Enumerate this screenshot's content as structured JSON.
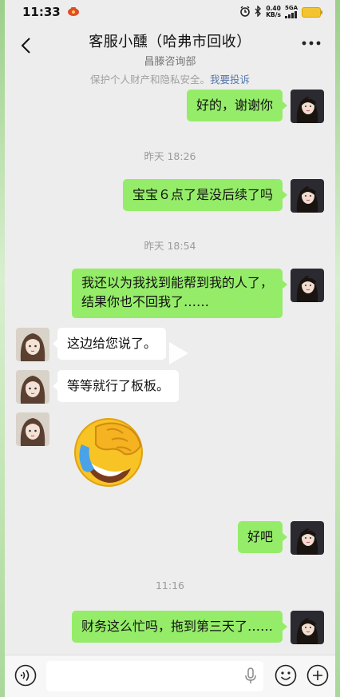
{
  "status_bar": {
    "time": "11:33",
    "speed_value": "0.40",
    "speed_unit": "KB/s",
    "network": "5GA"
  },
  "header": {
    "title": "客服小醺（哈弗市回收）",
    "subtitle": "昌滕咨询部",
    "privacy_text": "保护个人财产和隐私安全。",
    "complain_link": "我要投诉"
  },
  "messages": [
    {
      "text": "好的，谢谢你"
    },
    {
      "timestamp": "昨天 18:26"
    },
    {
      "text": "宝宝６点了是没后续了吗"
    },
    {
      "timestamp": "昨天 18:54"
    },
    {
      "text_line1": "我还以为我找到能帮到我的人了，",
      "text_line2": "结果你也不回我了……"
    },
    {
      "text": "这边给您说了。"
    },
    {
      "text": "等等就行了板板。"
    },
    {
      "sticker": "face-palm-laughing"
    },
    {
      "text": "好吧"
    },
    {
      "timestamp": "11:16"
    },
    {
      "text": "财务这么忙吗，拖到第三天了……"
    }
  ],
  "colors": {
    "my_bubble": "#95ec69",
    "their_bubble": "#ffffff",
    "background": "#ededed"
  }
}
